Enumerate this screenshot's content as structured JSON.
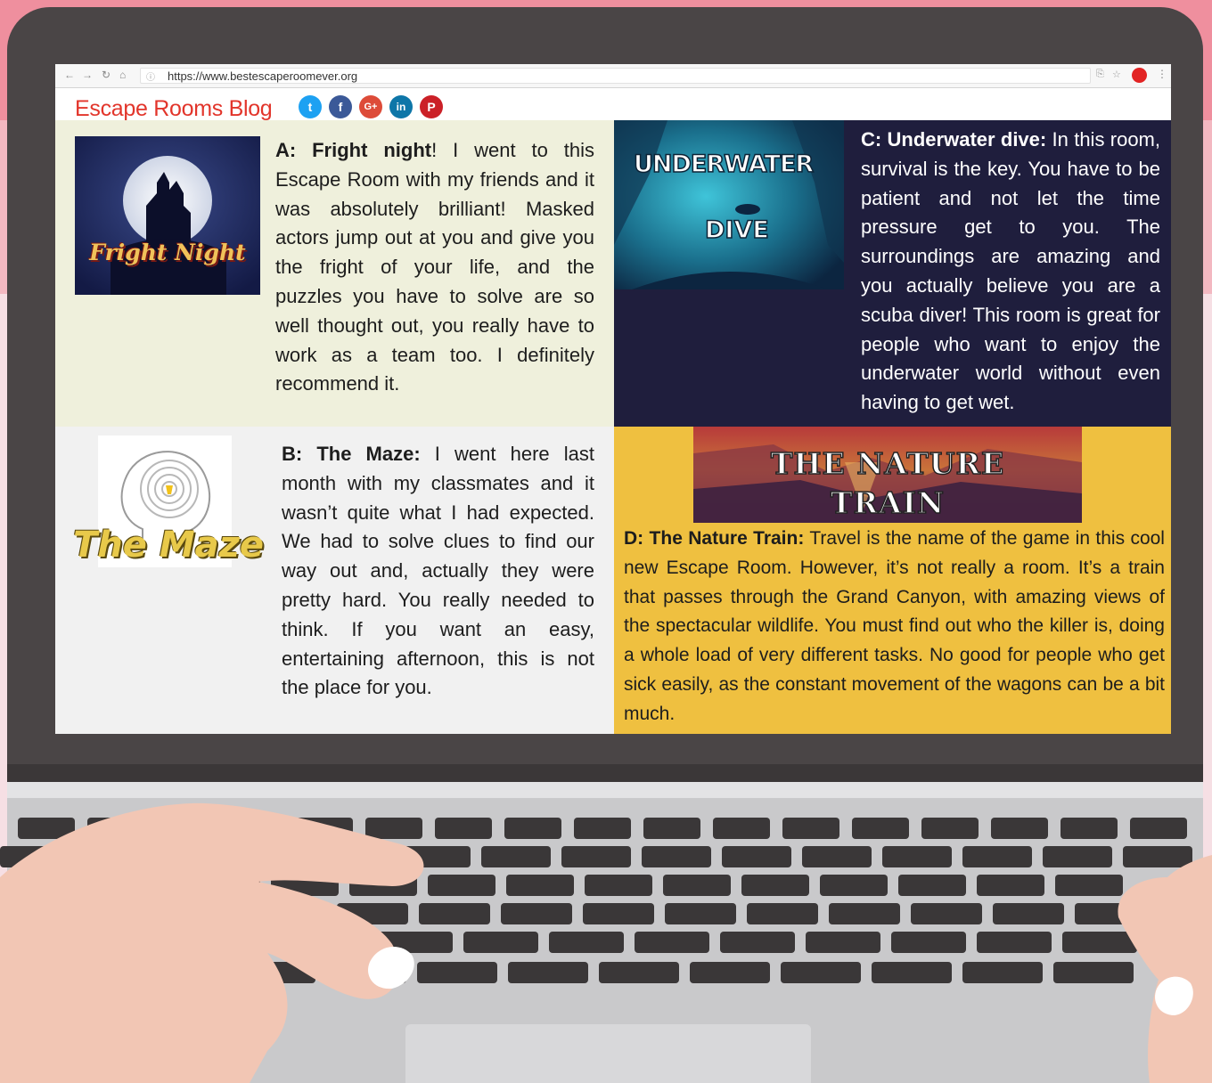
{
  "browser": {
    "url": "https://www.bestescaperoomever.org"
  },
  "blog": {
    "title": "Escape Rooms Blog",
    "social": [
      {
        "name": "twitter",
        "glyph": "t",
        "color": "#1da1f2"
      },
      {
        "name": "facebook",
        "glyph": "f",
        "color": "#3b5998"
      },
      {
        "name": "google-plus",
        "glyph": "G+",
        "color": "#dd4b39"
      },
      {
        "name": "linkedin",
        "glyph": "in",
        "color": "#0e76a8"
      },
      {
        "name": "pinterest",
        "glyph": "P",
        "color": "#cb2027"
      }
    ]
  },
  "reviews": {
    "a": {
      "heading": "A: Fright night",
      "text": "! I went to this Escape Room with my friends and it was absolutely brilliant! Masked actors jump out at you and give you the fright of your life, and the puzzles you have to solve are so well thought out, you really have to work as a team too. I definitely recommend it.",
      "image_text": "Fright Night"
    },
    "b": {
      "heading": "B: The Maze:",
      "text": " I went here last month with my classmates and it wasn’t quite what I had expected. We had to solve clues to find our way out and, actually they were pretty hard. You really needed to think. If you want an easy, entertaining afternoon, this is not the place for you.",
      "image_text": "The Maze"
    },
    "c": {
      "heading": "C: Underwater dive:",
      "text": " In this room, survival is the key. You have to be patient and not let the time pressure get to you. The surroundings are amazing and you actually believe you are a scuba diver! This room is great for people who want to enjoy the underwater world without even having to get wet.",
      "image_text_1": "UNDERWATER",
      "image_text_2": "DIVE"
    },
    "d": {
      "heading": "D: The Nature Train:",
      "text": " Travel is the name of the game in this cool new Escape Room. However, it’s not really a room. It’s a train that passes through the Grand Canyon, with amazing views of the spectacular wildlife. You must find out who the killer is, doing a whole load of very different tasks. No good for people who get sick easily, as the constant movement of the wagons can be a bit much.",
      "image_text_1": "THE NATURE",
      "image_text_2": "TRAIN"
    }
  },
  "colors": {
    "title_red": "#e2352b",
    "panel_a": "#eff0dc",
    "panel_c": "#1f1e3d",
    "panel_d": "#efc040"
  }
}
